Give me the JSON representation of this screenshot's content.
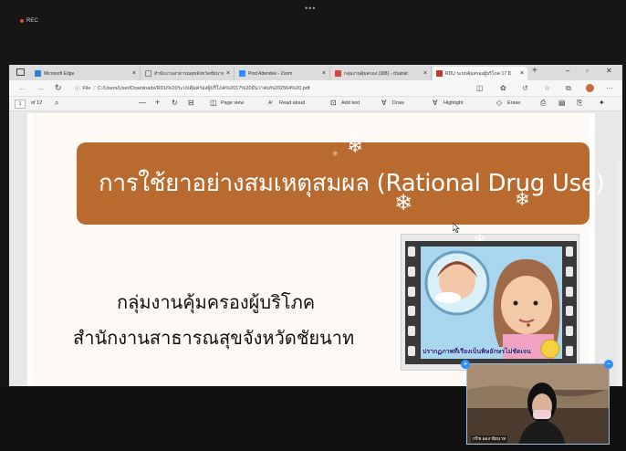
{
  "zoom": {
    "rec_label": "REC",
    "more_label": "•••"
  },
  "browser": {
    "tabs": [
      {
        "label": "Microsoft Edge",
        "icon": "edge-icon",
        "color": "#2f7fd8"
      },
      {
        "label": "สำนักงานสาธารณสุขจังหวัดชัยนาท",
        "icon": "page-icon",
        "color": "#888888"
      },
      {
        "label": "Post Attendee - Zoom",
        "icon": "zoom-icon",
        "color": "#2d8cff"
      },
      {
        "label": "กลุ่มงานคุ้มครอง (388) - chainat",
        "icon": "gmail-icon",
        "color": "#d44638"
      },
      {
        "label": "RDU ระบบคุ้มครองผู้บริโภค 17 มี",
        "icon": "pdf-icon",
        "color": "#c0392b"
      }
    ],
    "address": {
      "file_label": "File",
      "url": "C:/Users/User/Downloads/RDU%20ระบบคุ้มครองผู้บริโภค%2017%20ธันวาคม%202564%20.pdf"
    }
  },
  "pdf_toolbar": {
    "page_current": "1",
    "page_of": "of 12",
    "page_view": "Page view",
    "read_aloud": "Read aloud",
    "add_text": "Add text",
    "draw": "Draw",
    "highlight": "Highlight",
    "erase": "Erase"
  },
  "slide": {
    "title": "การใช้ยาอย่างสมเหตุสมผล (Rational Drug Use)",
    "subtitle_1": "กลุ่มงานคุ้มครองผู้บริโภค",
    "subtitle_2": "สำนักงานสาธารณสุขจังหวัดชัยนาท",
    "image_caption": "ปรากฏภาพที่เรียงเป็นพิษอักษรไม่ชัดเจน",
    "banner_color": "#b96a2f"
  },
  "self_video": {
    "name_label": "กริช ลอง ชัยนาท"
  }
}
